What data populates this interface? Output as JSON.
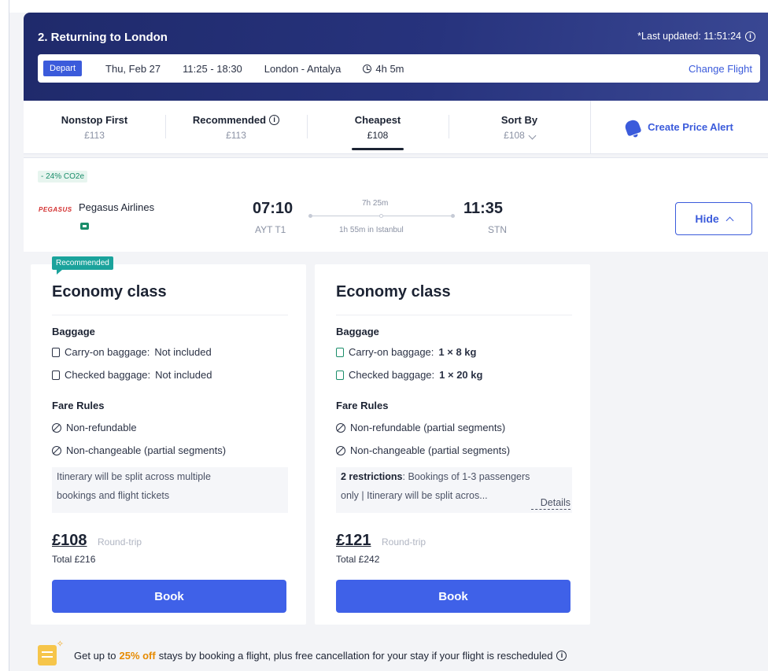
{
  "header": {
    "title": "2. Returning to London",
    "last_updated": "*Last updated: 11:51:24",
    "summary": {
      "badge": "Depart",
      "date": "Thu, Feb 27",
      "times": "11:25 - 18:30",
      "route": "London - Antalya",
      "duration": "4h 5m",
      "change_label": "Change Flight"
    }
  },
  "sort_tabs": [
    {
      "label": "Nonstop First",
      "price": "£113",
      "active": false
    },
    {
      "label": "Recommended",
      "price": "£113",
      "active": false
    },
    {
      "label": "Cheapest",
      "price": "£108",
      "active": true
    },
    {
      "label": "Sort By",
      "price": "£108",
      "active": false
    }
  ],
  "price_alert_label": "Create Price Alert",
  "flight": {
    "co2": "- 24% CO2e",
    "airline_logo_text": "PEGASUS",
    "airline": "Pegasus Airlines",
    "departure_time": "07:10",
    "departure_airport": "AYT T1",
    "duration": "7h 25m",
    "layover": "1h 55m in Istanbul",
    "arrival_time": "11:35",
    "arrival_airport": "STN",
    "hide_label": "Hide"
  },
  "fares": [
    {
      "badge": "Recommended",
      "class": "Economy class",
      "baggage_title": "Baggage",
      "carry_on_label": "Carry-on baggage:",
      "carry_on_value": "Not included",
      "checked_label": "Checked baggage:",
      "checked_value": "Not included",
      "rules_title": "Fare Rules",
      "rule_1": "Non-refundable",
      "rule_2": "Non-changeable (partial segments)",
      "note_line_1": "Itinerary will be split across multiple",
      "note_line_2": "bookings and flight tickets",
      "price": "£108",
      "price_type": "Round-trip",
      "total": "Total £216",
      "book_label": "Book"
    },
    {
      "class": "Economy class",
      "baggage_title": "Baggage",
      "carry_on_label": "Carry-on baggage:",
      "carry_on_value": "1 × 8 kg",
      "checked_label": "Checked baggage:",
      "checked_value": "1 × 20 kg",
      "rules_title": "Fare Rules",
      "rule_1": "Non-refundable (partial segments)",
      "rule_2": "Non-changeable (partial segments)",
      "note_bold": "2 restrictions",
      "note_line_1": ": Bookings of 1-3 passengers",
      "note_line_2": "only | Itinerary will be split acros...",
      "details_label": "Details",
      "price": "£121",
      "price_type": "Round-trip",
      "total": "Total £242",
      "book_label": "Book"
    }
  ],
  "promo": {
    "before": "Get up to",
    "accent": "25% off",
    "after": "stays by booking a flight, plus free cancellation for your stay if your flight is rescheduled",
    "accent_color": "#e68a00"
  }
}
